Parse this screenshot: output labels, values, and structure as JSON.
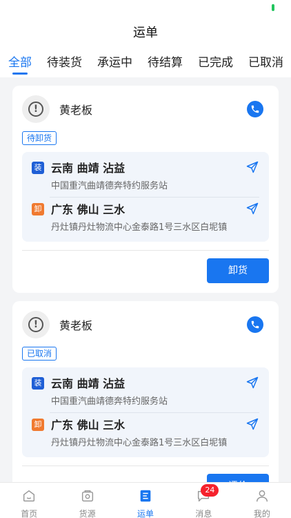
{
  "header": {
    "title": "运单"
  },
  "tabs": [
    {
      "label": "全部",
      "active": true
    },
    {
      "label": "待装货",
      "active": false
    },
    {
      "label": "承运中",
      "active": false
    },
    {
      "label": "待结算",
      "active": false
    },
    {
      "label": "已完成",
      "active": false
    },
    {
      "label": "已取消",
      "active": false
    }
  ],
  "orders": [
    {
      "owner": "黄老板",
      "status": "待卸货",
      "load": {
        "tag": "装",
        "city": "云南 曲靖 沾益",
        "address": "中国重汽曲靖德奔特约服务站"
      },
      "unload": {
        "tag": "卸",
        "city": "广东 佛山 三水",
        "address": "丹灶镇丹灶物流中心金泰路1号三水区白坭镇"
      },
      "action": "卸货"
    },
    {
      "owner": "黄老板",
      "status": "已取消",
      "load": {
        "tag": "装",
        "city": "云南 曲靖 沾益",
        "address": "中国重汽曲靖德奔特约服务站"
      },
      "unload": {
        "tag": "卸",
        "city": "广东 佛山 三水",
        "address": "丹灶镇丹灶物流中心金泰路1号三水区白坭镇"
      },
      "action": "评价"
    }
  ],
  "tabbar": [
    {
      "label": "首页",
      "icon": "home-icon",
      "active": false
    },
    {
      "label": "货源",
      "icon": "cargo-icon",
      "active": false
    },
    {
      "label": "运单",
      "icon": "waybill-icon",
      "active": true
    },
    {
      "label": "消息",
      "icon": "message-icon",
      "active": false,
      "badge": "24"
    },
    {
      "label": "我的",
      "icon": "user-icon",
      "active": false
    }
  ],
  "colors": {
    "accent": "#1976f0",
    "unload_tag": "#f07a30",
    "load_tag": "#1f5fd6",
    "badge": "#f5222d"
  }
}
